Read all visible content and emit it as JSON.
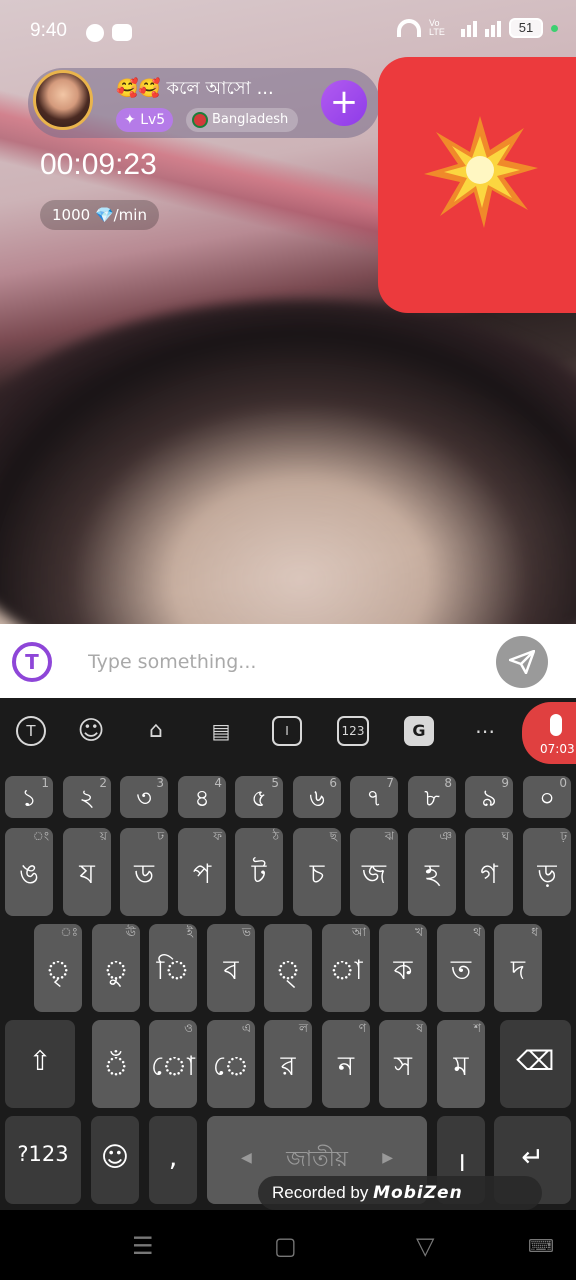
{
  "status_bar": {
    "time": "9:40",
    "volte": "Vo LTE",
    "battery": "51",
    "icons": [
      "messenger-icon",
      "youtube-icon",
      "wifi-icon",
      "signal-icon",
      "battery-icon"
    ]
  },
  "caller": {
    "name": "🥰🥰 কলে আসো ...",
    "level": "Lv5",
    "country": "Bangladesh",
    "follow_label": "+"
  },
  "call": {
    "timer": "00:09:23",
    "rate": "1000 💎/min"
  },
  "chat_input": {
    "placeholder": "Type something..."
  },
  "keyboard": {
    "toolbar": [
      "translate-icon",
      "emoji-icon",
      "store-icon",
      "clipboard-icon",
      "text-edit-icon",
      "numpad-icon",
      "gif-icon",
      "more-icon"
    ],
    "numpad_label": "123",
    "gif_label": "G",
    "mic_time": "07:03",
    "row1": [
      {
        "main": "১",
        "sup": "1"
      },
      {
        "main": "২",
        "sup": "2"
      },
      {
        "main": "৩",
        "sup": "3"
      },
      {
        "main": "৪",
        "sup": "4"
      },
      {
        "main": "৫",
        "sup": "5"
      },
      {
        "main": "৬",
        "sup": "6"
      },
      {
        "main": "৭",
        "sup": "7"
      },
      {
        "main": "৮",
        "sup": "8"
      },
      {
        "main": "৯",
        "sup": "9"
      },
      {
        "main": "০",
        "sup": "0"
      }
    ],
    "row2": [
      {
        "main": "ঙ",
        "sup": "ং"
      },
      {
        "main": "য",
        "sup": "য়"
      },
      {
        "main": "ড",
        "sup": "ঢ"
      },
      {
        "main": "প",
        "sup": "ফ"
      },
      {
        "main": "ট",
        "sup": "ঠ"
      },
      {
        "main": "চ",
        "sup": "ছ"
      },
      {
        "main": "জ",
        "sup": "ঝ"
      },
      {
        "main": "হ",
        "sup": "ঞ"
      },
      {
        "main": "গ",
        "sup": "ঘ"
      },
      {
        "main": "ড়",
        "sup": "ঢ়"
      }
    ],
    "row3": [
      {
        "main": "ৃ",
        "sup": "ঃ"
      },
      {
        "main": "ু",
        "sup": "ঊ"
      },
      {
        "main": "ি",
        "sup": "ই"
      },
      {
        "main": "ব",
        "sup": "ভ"
      },
      {
        "main": "্",
        "sup": ""
      },
      {
        "main": "া",
        "sup": "আ"
      },
      {
        "main": "ক",
        "sup": "খ"
      },
      {
        "main": "ত",
        "sup": "থ"
      },
      {
        "main": "দ",
        "sup": "ধ"
      }
    ],
    "row4": [
      {
        "main": "ঁ",
        "sup": ""
      },
      {
        "main": "ো",
        "sup": "ও"
      },
      {
        "main": "ে",
        "sup": "এ"
      },
      {
        "main": "র",
        "sup": "ল"
      },
      {
        "main": "ন",
        "sup": "ণ"
      },
      {
        "main": "স",
        "sup": "ষ"
      },
      {
        "main": "ম",
        "sup": "শ"
      }
    ],
    "shift_label": "⇧",
    "backspace_label": "⌫",
    "symbols_label": "?123",
    "emoji_label": "☺",
    "comma_label": ",",
    "space_label": "জাতীয়",
    "dari_label": "।",
    "enter_label": "↵"
  },
  "watermark": {
    "prefix": "Recorded by",
    "brand": "MobiZen"
  },
  "nav_bar": {
    "icons": [
      "recent-apps-icon",
      "home-icon",
      "back-icon",
      "keyboard-switch-icon"
    ]
  }
}
